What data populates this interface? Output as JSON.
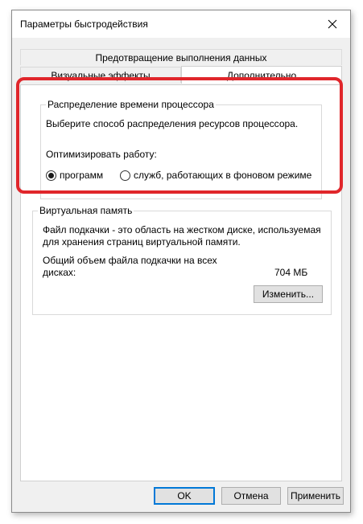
{
  "window": {
    "title": "Параметры быстродействия",
    "close_icon": "close-icon"
  },
  "tabs": [
    {
      "label": "Предотвращение выполнения данных",
      "active": false
    },
    {
      "label": "Визуальные эффекты",
      "active": false
    },
    {
      "label": "Дополнительно",
      "active": true
    }
  ],
  "cpu_group": {
    "title": "Распределение времени процессора",
    "description": "Выберите способ распределения ресурсов процессора.",
    "optimize_label": "Оптимизировать работу:",
    "options": [
      {
        "label": "программ",
        "selected": true
      },
      {
        "label": "служб, работающих в фоновом режиме",
        "selected": false
      }
    ]
  },
  "vm_group": {
    "title": "Виртуальная память",
    "description_line1": "Файл подкачки - это область на жестком диске, используемая",
    "description_line2": "для хранения страниц виртуальной памяти.",
    "total_label_line1": "Общий объем файла подкачки на всех",
    "total_label_line2": "дисках:",
    "total_value": "704 МБ",
    "change_button": "Изменить..."
  },
  "footer": {
    "ok": "OK",
    "cancel": "Отмена",
    "apply": "Применить"
  },
  "colors": {
    "highlight": "#e0262b",
    "accent": "#0078d7"
  }
}
